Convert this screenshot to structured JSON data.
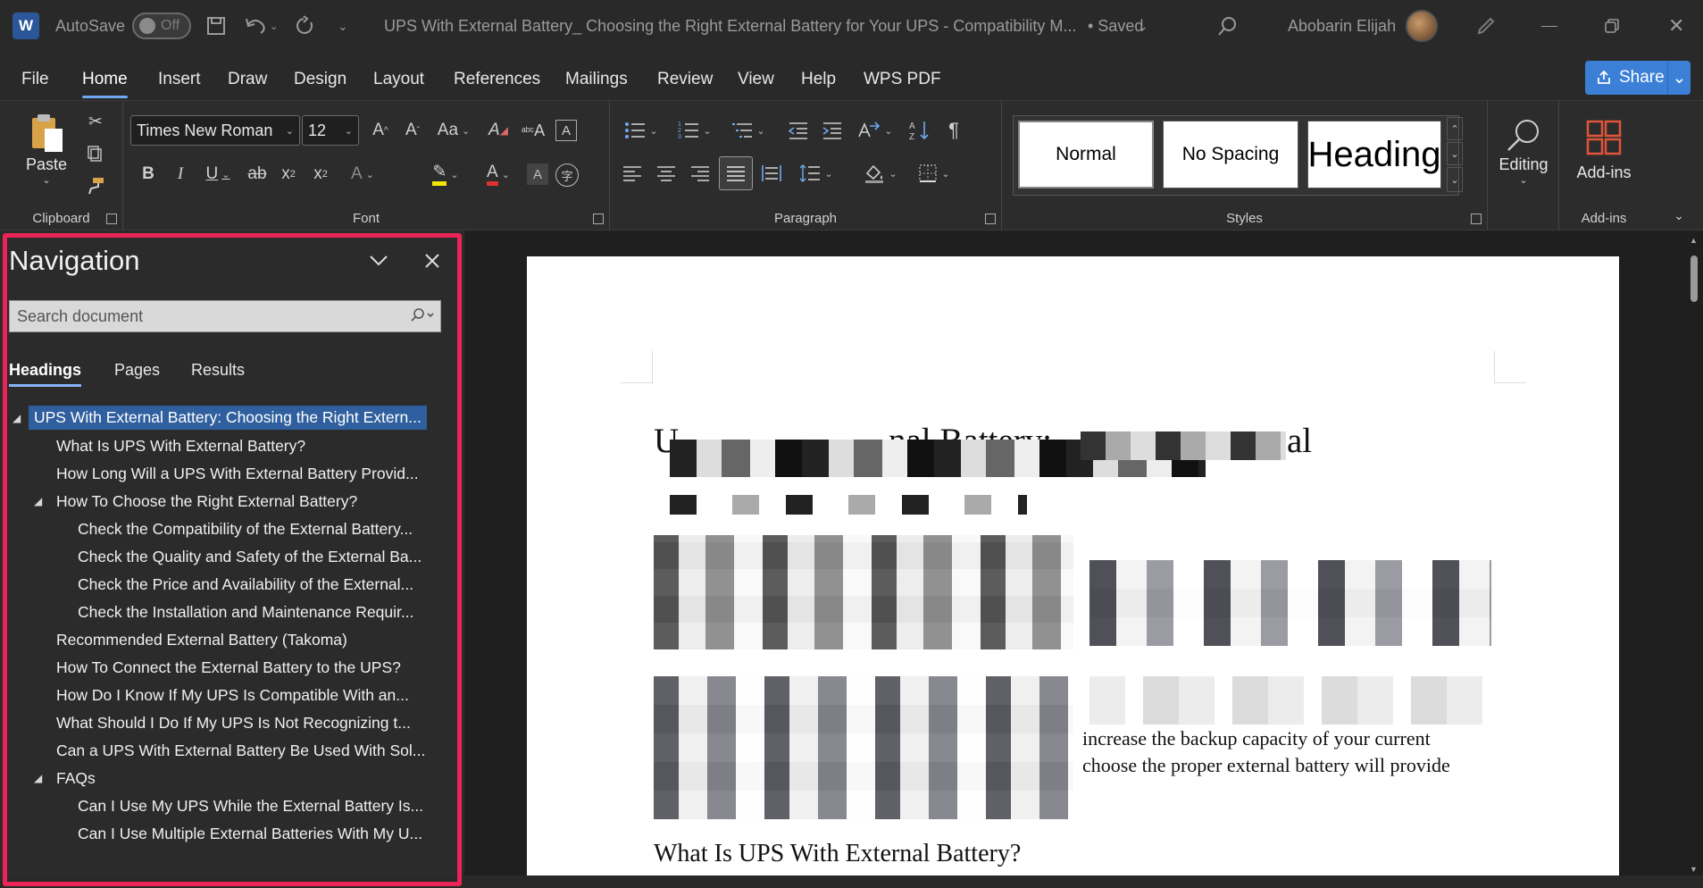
{
  "titlebar": {
    "app_letter": "W",
    "autosave_label": "AutoSave",
    "autosave_state": "Off",
    "doc_title": "UPS With External Battery_ Choosing the Right External Battery for Your UPS  -  Compatibility M...",
    "save_state": "• Saved",
    "user_name": "Abobarin Elijah"
  },
  "menu": [
    "File",
    "Home",
    "Insert",
    "Draw",
    "Design",
    "Layout",
    "References",
    "Mailings",
    "Review",
    "View",
    "Help",
    "WPS PDF"
  ],
  "share_label": "Share",
  "ribbon": {
    "clipboard": {
      "paste_label": "Paste",
      "group_label": "Clipboard"
    },
    "font": {
      "font_name": "Times New Roman",
      "font_size": "12",
      "group_label": "Font"
    },
    "paragraph": {
      "group_label": "Paragraph"
    },
    "styles": {
      "group_label": "Styles",
      "normal": "Normal",
      "no_spacing": "No Spacing",
      "heading": "Heading"
    },
    "editing": {
      "label": "Editing"
    },
    "addins": {
      "label": "Add-ins",
      "group_label": "Add-ins"
    }
  },
  "navigation": {
    "title": "Navigation",
    "search_placeholder": "Search document",
    "tabs": [
      "Headings",
      "Pages",
      "Results"
    ],
    "headings": [
      "UPS With External Battery: Choosing the Right Extern...",
      "What Is UPS With External Battery?",
      "How Long Will a UPS With External Battery Provid...",
      "How To Choose the Right External Battery?",
      "Check the Compatibility of the External Battery...",
      "Check the Quality and Safety of the External Ba...",
      "Check the Price and Availability of the External...",
      "Check the Installation and Maintenance Requir...",
      "Recommended External Battery (Takoma)",
      "How To Connect the External Battery to the UPS?",
      "How Do I Know If My UPS Is Compatible With an...",
      "What Should I Do If My UPS Is Not Recognizing t...",
      "Can a UPS With External Battery Be Used With Sol...",
      "FAQs",
      "Can I Use My UPS While the External Battery Is...",
      "Can I Use Multiple External Batteries With My U..."
    ]
  },
  "document": {
    "title_fragment_1": "U",
    "title_fragment_2": "nal Battery:",
    "title_fragment_3": "al",
    "body_fragment_1": "increase the backup capacity of your current",
    "body_fragment_2": "choose the proper external battery will provide",
    "subheading": "What Is UPS With External Battery?"
  }
}
